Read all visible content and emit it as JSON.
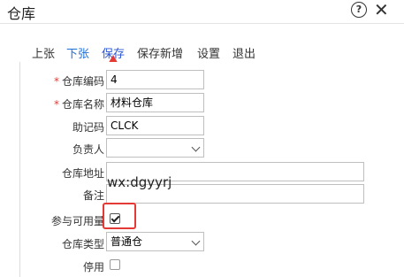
{
  "window": {
    "title": "仓库"
  },
  "toolbar": {
    "items": [
      {
        "label": "上张"
      },
      {
        "label": "下张"
      },
      {
        "label": "保存"
      },
      {
        "label": "保存新增"
      },
      {
        "label": "设置"
      },
      {
        "label": "退出"
      }
    ]
  },
  "form": {
    "code": {
      "label": "仓库编码",
      "value": "4"
    },
    "name": {
      "label": "仓库名称",
      "value": "材料仓库"
    },
    "mnemonic": {
      "label": "助记码",
      "value": "CLCK"
    },
    "manager": {
      "label": "负责人",
      "value": ""
    },
    "address": {
      "label": "仓库地址",
      "value": ""
    },
    "remark": {
      "label": "备注",
      "value": ""
    },
    "available": {
      "label": "参与可用量",
      "checked": true
    },
    "type": {
      "label": "仓库类型",
      "value": "普通仓"
    },
    "disabled": {
      "label": "停用",
      "checked": false
    }
  },
  "watermark": "wx:dgyyrj",
  "colors": {
    "accent": "#1e6fd6",
    "annotation": "#e53935"
  }
}
